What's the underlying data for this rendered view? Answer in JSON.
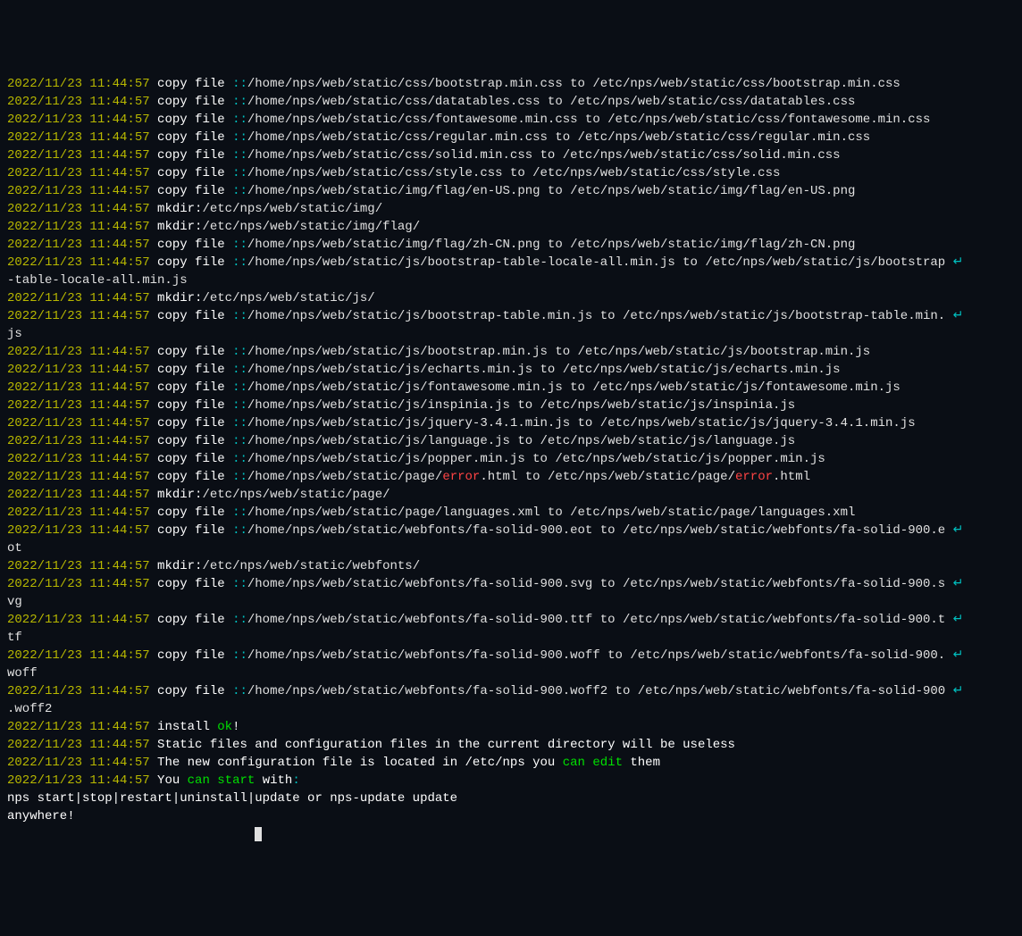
{
  "timestamp": "2022/11/23 11:44:57",
  "copy_prefix": "copy file ",
  "dcolon": "::",
  "mkdir_prefix": "mkdir:",
  "lines": [
    {
      "type": "copy",
      "src": "/home/nps/web/static/css/bootstrap.min.css",
      "dst": "/etc/nps/web/static/css/bootstrap.min.css"
    },
    {
      "type": "copy",
      "src": "/home/nps/web/static/css/datatables.css",
      "dst": "/etc/nps/web/static/css/datatables.css"
    },
    {
      "type": "copy",
      "src": "/home/nps/web/static/css/fontawesome.min.css",
      "dst": "/etc/nps/web/static/css/fontawesome.min.css"
    },
    {
      "type": "copy",
      "src": "/home/nps/web/static/css/regular.min.css",
      "dst": "/etc/nps/web/static/css/regular.min.css"
    },
    {
      "type": "copy",
      "src": "/home/nps/web/static/css/solid.min.css",
      "dst": "/etc/nps/web/static/css/solid.min.css"
    },
    {
      "type": "copy",
      "src": "/home/nps/web/static/css/style.css",
      "dst": "/etc/nps/web/static/css/style.css"
    },
    {
      "type": "copy",
      "src": "/home/nps/web/static/img/flag/en-US.png",
      "dst": "/etc/nps/web/static/img/flag/en-US.png"
    },
    {
      "type": "mkdir",
      "path": "/etc/nps/web/static/img/"
    },
    {
      "type": "mkdir",
      "path": "/etc/nps/web/static/img/flag/"
    },
    {
      "type": "copy",
      "src": "/home/nps/web/static/img/flag/zh-CN.png",
      "dst": "/etc/nps/web/static/img/flag/zh-CN.png"
    },
    {
      "type": "copy_wrap",
      "src": "/home/nps/web/static/js/bootstrap-table-locale-all.min.js",
      "dst_pre": "/etc/nps/web/static/js/bootstrap",
      "dst_post": "-table-locale-all.min.js"
    },
    {
      "type": "mkdir",
      "path": "/etc/nps/web/static/js/"
    },
    {
      "type": "copy_wrap",
      "src": "/home/nps/web/static/js/bootstrap-table.min.js",
      "dst_pre": "/etc/nps/web/static/js/bootstrap-table.min.",
      "dst_post": "js"
    },
    {
      "type": "copy",
      "src": "/home/nps/web/static/js/bootstrap.min.js",
      "dst": "/etc/nps/web/static/js/bootstrap.min.js"
    },
    {
      "type": "copy",
      "src": "/home/nps/web/static/js/echarts.min.js",
      "dst": "/etc/nps/web/static/js/echarts.min.js"
    },
    {
      "type": "copy",
      "src": "/home/nps/web/static/js/fontawesome.min.js",
      "dst": "/etc/nps/web/static/js/fontawesome.min.js"
    },
    {
      "type": "copy",
      "src": "/home/nps/web/static/js/inspinia.js",
      "dst": "/etc/nps/web/static/js/inspinia.js"
    },
    {
      "type": "copy",
      "src": "/home/nps/web/static/js/jquery-3.4.1.min.js",
      "dst": "/etc/nps/web/static/js/jquery-3.4.1.min.js"
    },
    {
      "type": "copy",
      "src": "/home/nps/web/static/js/language.js",
      "dst": "/etc/nps/web/static/js/language.js"
    },
    {
      "type": "copy",
      "src": "/home/nps/web/static/js/popper.min.js",
      "dst": "/etc/nps/web/static/js/popper.min.js"
    },
    {
      "type": "copy_error",
      "src_pre": "/home/nps/web/static/page/",
      "src_err": "error",
      "src_post": ".html",
      "dst_pre": "/etc/nps/web/static/page/",
      "dst_err": "error",
      "dst_post": ".html"
    },
    {
      "type": "mkdir",
      "path": "/etc/nps/web/static/page/"
    },
    {
      "type": "copy",
      "src": "/home/nps/web/static/page/languages.xml",
      "dst": "/etc/nps/web/static/page/languages.xml"
    },
    {
      "type": "copy_wrap",
      "src": "/home/nps/web/static/webfonts/fa-solid-900.eot",
      "dst_pre": "/etc/nps/web/static/webfonts/fa-solid-900.e",
      "dst_post": "ot"
    },
    {
      "type": "mkdir",
      "path": "/etc/nps/web/static/webfonts/"
    },
    {
      "type": "copy_wrap",
      "src": "/home/nps/web/static/webfonts/fa-solid-900.svg",
      "dst_pre": "/etc/nps/web/static/webfonts/fa-solid-900.s",
      "dst_post": "vg"
    },
    {
      "type": "copy_wrap",
      "src": "/home/nps/web/static/webfonts/fa-solid-900.ttf",
      "dst_pre": "/etc/nps/web/static/webfonts/fa-solid-900.t",
      "dst_post": "tf"
    },
    {
      "type": "copy_wrap",
      "src": "/home/nps/web/static/webfonts/fa-solid-900.woff",
      "dst_pre": "/etc/nps/web/static/webfonts/fa-solid-900.",
      "dst_post": "woff"
    },
    {
      "type": "copy_wrap",
      "src": "/home/nps/web/static/webfonts/fa-solid-900.woff2",
      "dst_pre": "/etc/nps/web/static/webfonts/fa-solid-900",
      "dst_post": ".woff2"
    }
  ],
  "install_line": {
    "prefix": "install ",
    "ok": "ok",
    "suffix": "!"
  },
  "static_line": "Static files and configuration files in the current directory will be useless",
  "config_line": {
    "pre": "The new configuration file is located in /etc/nps you ",
    "can": "can",
    "space": " ",
    "edit": "edit",
    "post": " them"
  },
  "start_line": {
    "pre": "You ",
    "can": "can",
    "space": " ",
    "start": "start",
    "post": " with",
    "colon": ":"
  },
  "cmd_line": "nps start|stop|restart|uninstall|update or nps-update update",
  "anywhere": "anywhere!",
  "to": " to ",
  "wrap_mark": "↵"
}
